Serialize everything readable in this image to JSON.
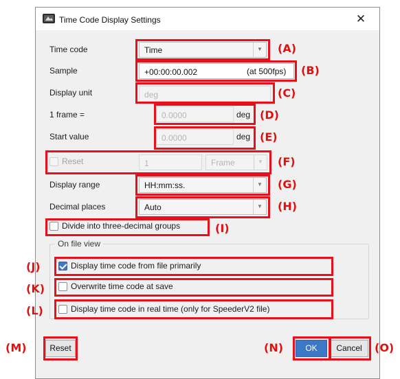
{
  "window": {
    "title": "Time Code Display Settings",
    "close_glyph": "✕",
    "icon": "app-icon"
  },
  "form": {
    "time_code": {
      "label": "Time code",
      "value": "Time"
    },
    "sample": {
      "label": "Sample",
      "value": "+00:00:00.002",
      "suffix": "(at 500fps)"
    },
    "display_unit": {
      "label": "Display unit",
      "placeholder": "deg"
    },
    "one_frame": {
      "label": "1 frame =",
      "value": "0.0000",
      "unit": "deg"
    },
    "start_value": {
      "label": "Start value",
      "value": "0.0000",
      "unit": "deg"
    },
    "reset_row": {
      "label": "Reset",
      "value": "1",
      "unit": "Frame",
      "checked": false
    },
    "display_range": {
      "label": "Display range",
      "value": "HH:mm:ss."
    },
    "decimal_places": {
      "label": "Decimal places",
      "value": "Auto"
    },
    "divide_groups": {
      "label": "Divide into three-decimal groups",
      "checked": false
    }
  },
  "file_view": {
    "legend": "On file view",
    "options": [
      {
        "label": "Display time code from file primarily",
        "checked": true
      },
      {
        "label": "Overwrite time code at save",
        "checked": false
      },
      {
        "label": "Display time code in real time (only for SpeederV2 file)",
        "checked": false
      }
    ]
  },
  "buttons": {
    "reset": "Reset",
    "ok": "OK",
    "cancel": "Cancel"
  },
  "annotations": {
    "a": "(A)",
    "b": "(B)",
    "c": "(C)",
    "d": "(D)",
    "e": "(E)",
    "f": "(F)",
    "g": "(G)",
    "h": "(H)",
    "i": "(I)",
    "j": "(J)",
    "k": "(K)",
    "l": "(L)",
    "m": "(M)",
    "n": "(N)",
    "o": "(O)"
  },
  "colors": {
    "annotation_red": "#e8101a",
    "primary_blue": "#3d78c7",
    "dialog_bg": "#f0f0f0"
  }
}
